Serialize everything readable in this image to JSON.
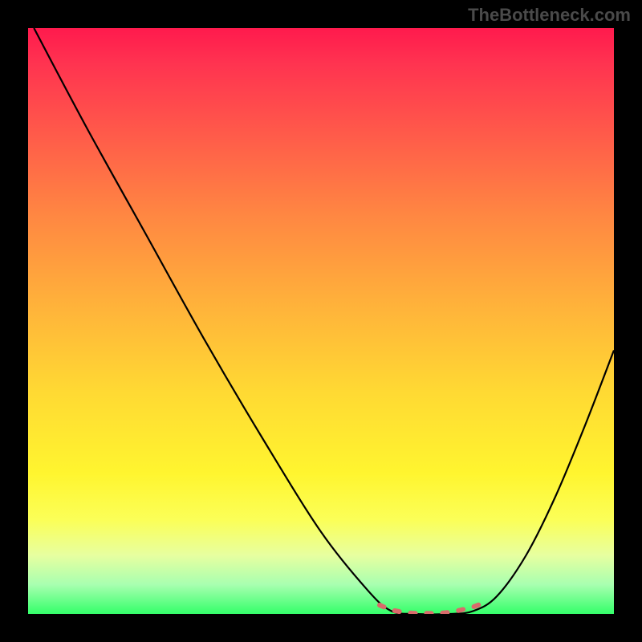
{
  "watermark": "TheBottleneck.com",
  "chart_data": {
    "type": "line",
    "title": "",
    "xlabel": "",
    "ylabel": "",
    "xlim": [
      0,
      100
    ],
    "ylim": [
      0,
      100
    ],
    "grid": false,
    "series": [
      {
        "name": "curve",
        "x": [
          1,
          10,
          20,
          30,
          40,
          50,
          58,
          62,
          66,
          72,
          76,
          80,
          85,
          90,
          95,
          100
        ],
        "y": [
          100,
          83,
          65,
          47,
          30,
          14,
          4,
          0.5,
          0,
          0,
          0.5,
          3,
          10,
          20,
          32,
          45
        ],
        "color": "#000000"
      },
      {
        "name": "highlight",
        "x": [
          60,
          62,
          64,
          66,
          68,
          70,
          72,
          74,
          76,
          78
        ],
        "y": [
          1.5,
          0.7,
          0.3,
          0.1,
          0.1,
          0.1,
          0.3,
          0.7,
          1.2,
          2
        ],
        "style": "dashed",
        "color": "#d96b6b"
      }
    ],
    "background_gradient": {
      "direction": "vertical",
      "stops": [
        {
          "pos": 0,
          "color": "#ff1a4d"
        },
        {
          "pos": 50,
          "color": "#ffc838"
        },
        {
          "pos": 85,
          "color": "#feff4a"
        },
        {
          "pos": 100,
          "color": "#34ff6a"
        }
      ]
    }
  }
}
